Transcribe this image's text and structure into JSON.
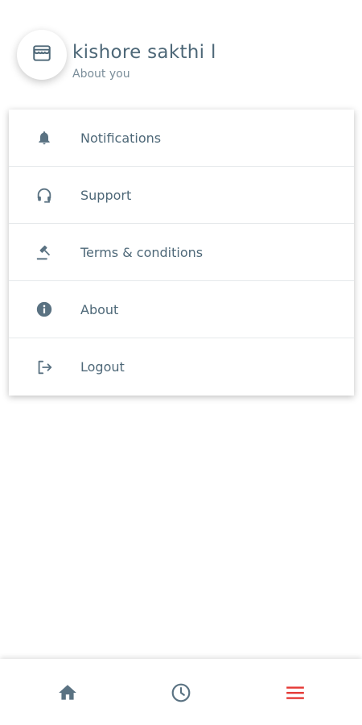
{
  "header": {
    "avatar_icon": "store-icon",
    "name": "kishore sakthi l",
    "subtitle": "About you"
  },
  "menu": {
    "items": [
      {
        "label": "Notifications",
        "icon": "bell-icon"
      },
      {
        "label": "Support",
        "icon": "headphones-icon"
      },
      {
        "label": "Terms & conditions",
        "icon": "gavel-icon"
      },
      {
        "label": "About",
        "icon": "info-icon"
      },
      {
        "label": "Logout",
        "icon": "logout-icon"
      }
    ]
  },
  "bottom_nav": {
    "items": [
      {
        "icon": "home-icon",
        "active": false
      },
      {
        "icon": "history-icon",
        "active": false
      },
      {
        "icon": "menu-icon",
        "active": true
      }
    ]
  },
  "colors": {
    "text": "#4e6878",
    "icon": "#5a7282",
    "active": "#e53935",
    "divider": "#e6e9eb"
  }
}
